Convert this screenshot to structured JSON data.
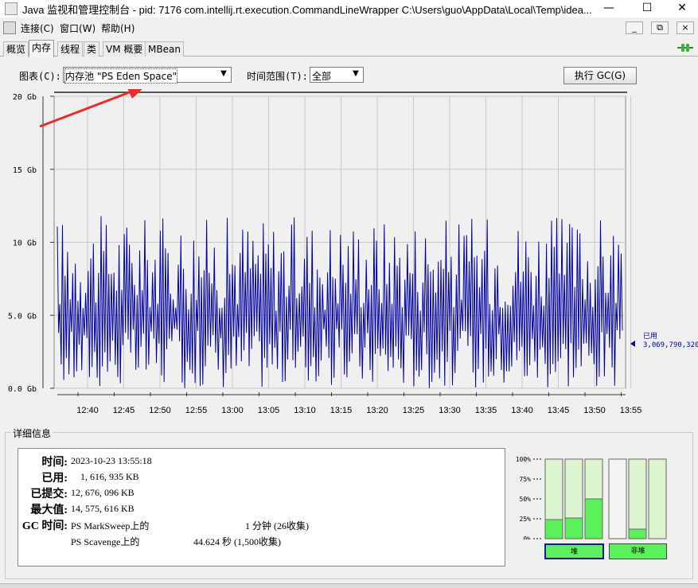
{
  "window": {
    "title": "Java 监视和管理控制台 - pid: 7176 com.intellij.rt.execution.CommandLineWrapper C:\\Users\\guo\\AppData\\Local\\Temp\\idea...",
    "minimize": "—",
    "maximize": "☐",
    "close": "✕"
  },
  "menu": {
    "items": [
      "连接(C)",
      "窗口(W)",
      "帮助(H)"
    ],
    "mdi": [
      "_",
      "⧉",
      "×"
    ]
  },
  "tabs": [
    "概览",
    "内存",
    "线程",
    "类",
    "VM 概要",
    "MBean"
  ],
  "active_tab": 1,
  "toolbar": {
    "chart_label": "图表(C):",
    "chart_value": "内存池 \"PS Eden Space\"",
    "range_label": "时间范围(T):",
    "range_value": "全部",
    "gc_button": "执行 GC(G)"
  },
  "chart_data": {
    "type": "line",
    "y_ticks": [
      "20 Gb",
      "15 Gb",
      "10 Gb",
      "5.0 Gb",
      "0.0 Gb"
    ],
    "y_values": [
      20,
      15,
      10,
      5,
      0
    ],
    "ylim": [
      0,
      20
    ],
    "x_ticks": [
      "12:40",
      "12:45",
      "12:50",
      "12:55",
      "13:00",
      "13:05",
      "13:10",
      "13:15",
      "13:20",
      "13:25",
      "13:30",
      "13:35",
      "13:40",
      "13:45",
      "13:50",
      "13:55"
    ],
    "grid": true,
    "series": [
      {
        "color": "#0000a0",
        "value_range_gb": [
          0,
          11.8
        ]
      }
    ],
    "legend_title": "已用",
    "legend_value": "3,069,790,320",
    "colors": {
      "plot_bg": "#f0f0f0",
      "grid": "#c8c8c8",
      "line": "#0000a0",
      "arrow": "#e8302a"
    }
  },
  "details": {
    "title": "详细信息",
    "rows": [
      {
        "key": "时间:",
        "value": "2023-10-23 13:55:18"
      },
      {
        "key": "已用:",
        "value": "1, 616, 935 KB"
      },
      {
        "key": "已提交:",
        "value": "12, 676, 096 KB"
      },
      {
        "key": "最大值:",
        "value": "14, 575, 616 KB"
      },
      {
        "key": "GC 时间:",
        "value": "PS MarkSweep上的"
      }
    ],
    "gc_ps_marksweep_time": "1 分钟 (26收集)",
    "gc_ps_scavenge_name": "PS Scavenge上的",
    "gc_ps_scavenge_time": "44.624 秒 (1,500收集)"
  },
  "pool_bars": {
    "scale": [
      "100%",
      "75%",
      "50%",
      "25%",
      "0%"
    ],
    "heap_fill": [
      0.24,
      0.26,
      0.5
    ],
    "nonheap_fill": [
      0.0,
      0.12,
      0.0
    ],
    "heap_label": "堆",
    "nonheap_label": "非堆",
    "colors": {
      "fill": "#5cf05c",
      "empty": "#dcf5d0",
      "heap_selected": "#1a1a8a"
    }
  }
}
